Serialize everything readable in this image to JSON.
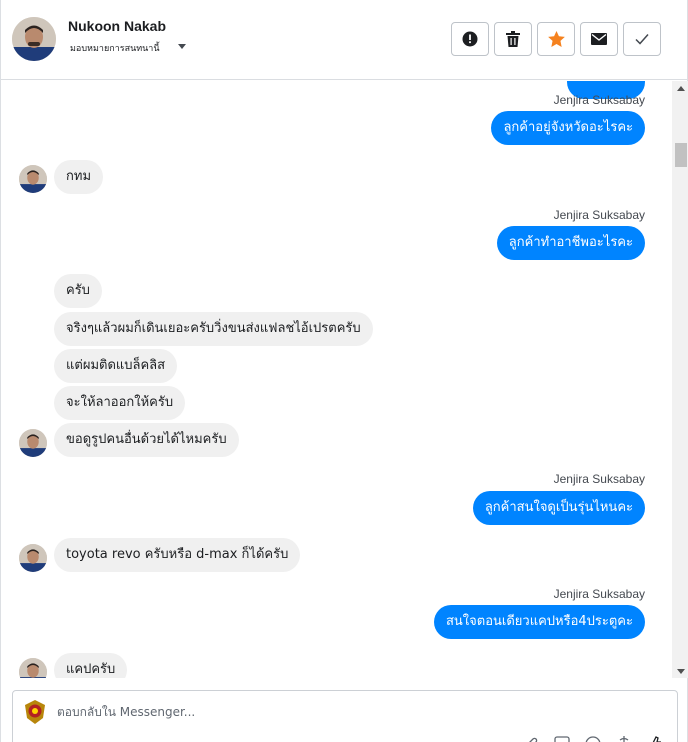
{
  "header": {
    "name": "Nukoon Nakab",
    "assign_label": "มอบหมายการสนทนานี้",
    "tools": [
      "report-icon",
      "trash-icon",
      "star-icon",
      "envelope-icon",
      "check-icon"
    ]
  },
  "colors": {
    "outgoing_bubble": "#0084ff",
    "incoming_bubble": "#f0f0f0",
    "star": "#f5821f"
  },
  "messages": [
    {
      "dir": "out",
      "sender": "Jenjira Suksabay",
      "text": "ลูกค้าอยู่จังหวัดอะไรคะ"
    },
    {
      "dir": "in",
      "text": "กทม"
    },
    {
      "dir": "out",
      "sender": "Jenjira Suksabay",
      "text": "ลูกค้าทำอาชีพอะไรคะ"
    },
    {
      "dir": "in",
      "text": "ครับ"
    },
    {
      "dir": "in",
      "text": "จริงๆแล้วผมก็เดินเยอะครับวิ่งขนส่งแฟลชไอ้เปรตครับ"
    },
    {
      "dir": "in",
      "text": "แต่ผมติดแบล็คลิส"
    },
    {
      "dir": "in",
      "text": "จะให้ลาออกให้ครับ"
    },
    {
      "dir": "in",
      "text": "ขอดูรูปคนอื่นด้วยได้ไหมครับ"
    },
    {
      "dir": "out",
      "sender": "Jenjira Suksabay",
      "text": "ลูกค้าสนใจดูเป็นรุ่นไหนคะ"
    },
    {
      "dir": "in",
      "text": "toyota revo ครับหรือ d-max ก็ได้ครับ"
    },
    {
      "dir": "out",
      "sender": "Jenjira Suksabay",
      "text": "สนใจตอนเดียวแคปหรือ4ประตูคะ"
    },
    {
      "dir": "in",
      "text": "แคปครับ"
    }
  ],
  "reply": {
    "placeholder": "ตอบกลับใน Messenger..."
  }
}
